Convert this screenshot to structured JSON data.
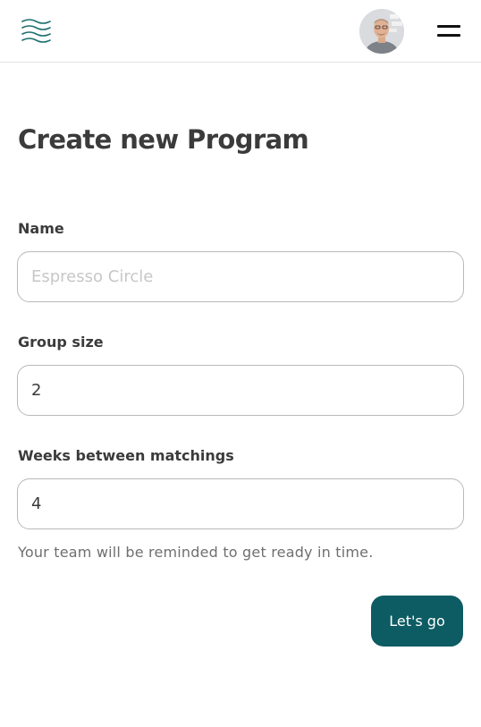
{
  "header": {
    "logo_icon": "waves-logo-icon",
    "avatar_icon": "user-avatar",
    "menu_icon": "hamburger-menu-icon"
  },
  "page": {
    "title": "Create new Program"
  },
  "form": {
    "name": {
      "label": "Name",
      "placeholder": "Espresso Circle",
      "value": ""
    },
    "group_size": {
      "label": "Group size",
      "value": "2"
    },
    "weeks_between": {
      "label": "Weeks between matchings",
      "value": "4"
    },
    "hint": "Your team will be reminded to get ready in time.",
    "submit_label": "Let's go"
  },
  "colors": {
    "accent": "#0d5c63",
    "input_border": "#b9b9b9",
    "divider": "#e4e4e4"
  }
}
